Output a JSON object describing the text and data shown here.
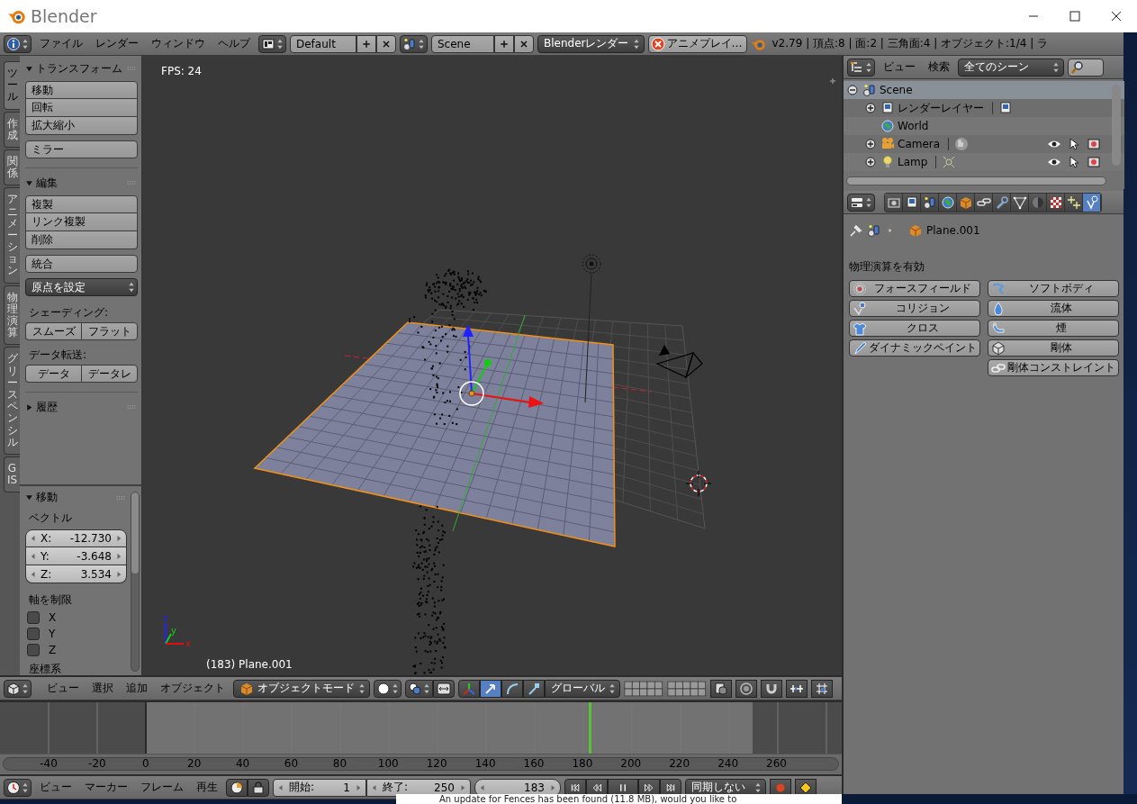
{
  "window": {
    "title": "Blender"
  },
  "info_header": {
    "menus": [
      "ファイル",
      "レンダー",
      "ウィンドウ",
      "ヘルプ"
    ],
    "layout": "Default",
    "scene": "Scene",
    "engine": "Blenderレンダー",
    "playback_warning": "アニメプレイ…",
    "stats": "v2.79 | 頂点:8 | 面:2 | 三角面:4 | オブジェクト:1/4 | ラ"
  },
  "tool_tabs": [
    {
      "label": "ツール",
      "selected": true
    },
    {
      "label": "作成",
      "selected": false
    },
    {
      "label": "関係",
      "selected": false
    },
    {
      "label": "アニメーション",
      "selected": false
    },
    {
      "label": "物理演算",
      "selected": false
    },
    {
      "label": "グリースペンシル",
      "selected": false
    },
    {
      "label": "GIS",
      "selected": false
    }
  ],
  "transform_panel": {
    "title": "トランスフォーム",
    "expanded": true,
    "buttons": [
      "移動",
      "回転",
      "拡大縮小"
    ],
    "mirror": "ミラー"
  },
  "edit_panel": {
    "title": "編集",
    "expanded": true,
    "buttons": [
      "複製",
      "リンク複製",
      "削除"
    ],
    "join": "統合",
    "origin_menu": "原点を設定",
    "shading_label": "シェーディング:",
    "shading_buttons": [
      "スムーズ",
      "フラット"
    ],
    "transfer_label": "データ転送:",
    "transfer_buttons": [
      "データ",
      "データレ"
    ]
  },
  "history_panel": {
    "title": "履歴",
    "expanded": false
  },
  "operator_panel": {
    "title": "移動",
    "expanded": true,
    "vector_label": "ベクトル",
    "vector": [
      {
        "axis": "X:",
        "value": "-12.730"
      },
      {
        "axis": "Y:",
        "value": "-3.648"
      },
      {
        "axis": "Z:",
        "value": "3.534"
      }
    ],
    "constraint_label": "軸を制限",
    "constraints": [
      {
        "label": "X",
        "checked": false
      },
      {
        "label": "Y",
        "checked": false
      },
      {
        "label": "Z",
        "checked": false
      }
    ],
    "orientation_label": "座標系"
  },
  "viewport": {
    "fps": "FPS: 24",
    "object_info": "(183) Plane.001",
    "axes": [
      "x",
      "y",
      "z"
    ]
  },
  "view3d_header": {
    "menus": [
      "ビュー",
      "選択",
      "追加",
      "オブジェクト"
    ],
    "mode": "オブジェクトモード",
    "manipulators": [
      {
        "kind": "translate",
        "selected": true
      },
      {
        "kind": "rotate",
        "selected": false
      },
      {
        "kind": "scale",
        "selected": false
      }
    ],
    "orientation": "グローバル"
  },
  "timeline": {
    "ticks": [
      "-40",
      "-20",
      "0",
      "20",
      "40",
      "60",
      "80",
      "100",
      "120",
      "140",
      "160",
      "180",
      "200",
      "220",
      "240",
      "260"
    ]
  },
  "timeline_header": {
    "menus": [
      "ビュー",
      "マーカー",
      "フレーム",
      "再生"
    ],
    "start_label": "開始:",
    "start": "1",
    "end_label": "終了:",
    "end": "250",
    "current": "183",
    "sync": "同期しない"
  },
  "outliner": {
    "menus": [
      "ビュー",
      "検索"
    ],
    "filter": "全てのシーン",
    "items": [
      {
        "label": "Scene",
        "kind": "scene",
        "expanded": true,
        "selected": true,
        "children": [
          {
            "label": "レンダーレイヤー",
            "kind": "renderlayer",
            "expanded": false,
            "selected": false
          },
          {
            "label": "World",
            "kind": "world",
            "selected": false
          },
          {
            "label": "Camera",
            "kind": "camera",
            "expanded": false,
            "selected": false,
            "visible": true,
            "selectable": true,
            "renderable": true
          },
          {
            "label": "Lamp",
            "kind": "lamp",
            "expanded": false,
            "selected": false,
            "visible": true,
            "selectable": true,
            "renderable": true
          }
        ]
      }
    ]
  },
  "properties": {
    "tabs": [
      {
        "kind": "render",
        "selected": false
      },
      {
        "kind": "layers",
        "selected": false
      },
      {
        "kind": "scene",
        "selected": false
      },
      {
        "kind": "world",
        "selected": false
      },
      {
        "kind": "object",
        "selected": false
      },
      {
        "kind": "constraints",
        "selected": false
      },
      {
        "kind": "modifiers",
        "selected": false
      },
      {
        "kind": "data",
        "selected": false
      },
      {
        "kind": "material",
        "selected": false
      },
      {
        "kind": "texture",
        "selected": false
      },
      {
        "kind": "particles",
        "selected": false
      },
      {
        "kind": "physics",
        "selected": true
      }
    ],
    "breadcrumb": "Plane.001",
    "section": "物理演算を有効",
    "left_buttons": [
      {
        "label": "フォースフィールド",
        "kind": "force"
      },
      {
        "label": "コリジョン",
        "kind": "collision"
      },
      {
        "label": "クロス",
        "kind": "cloth"
      },
      {
        "label": "ダイナミックペイント",
        "kind": "dynamicpaint"
      }
    ],
    "right_buttons": [
      {
        "label": "ソフトボディ",
        "kind": "softbody"
      },
      {
        "label": "流体",
        "kind": "fluid"
      },
      {
        "label": "煙",
        "kind": "smoke"
      },
      {
        "label": "剛体",
        "kind": "rigidbody"
      },
      {
        "label": "剛体コンストレイント",
        "kind": "rigidconstraint"
      }
    ]
  },
  "notification": "An update for Fences has been found (11.8 MB), would you like to"
}
